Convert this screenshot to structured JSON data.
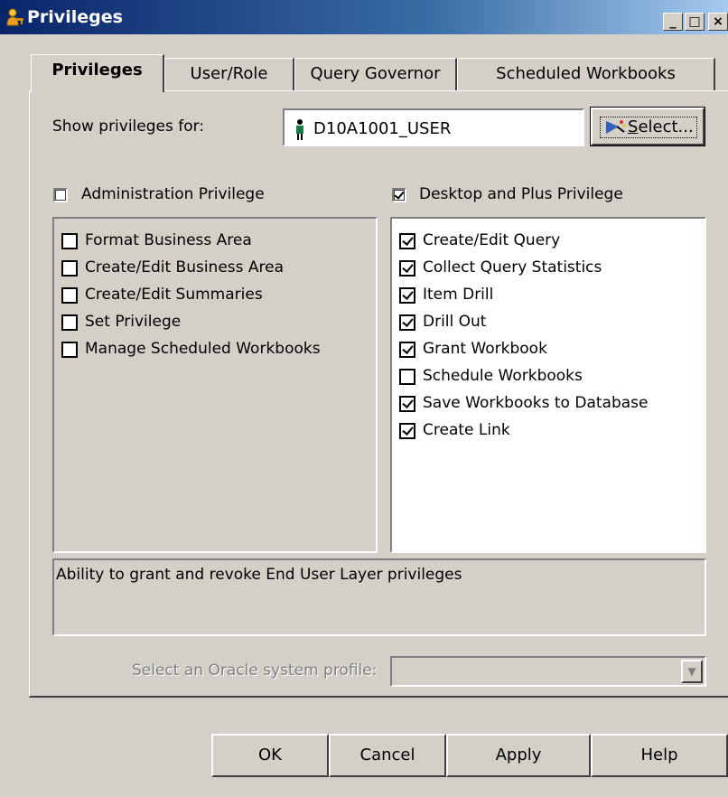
{
  "window": {
    "title": "Privileges",
    "controls": {
      "minimize": "_",
      "maximize": "□",
      "close": "×"
    }
  },
  "tabs": [
    {
      "label": "Privileges",
      "active": true
    },
    {
      "label": "User/Role",
      "active": false
    },
    {
      "label": "Query Governor",
      "active": false
    },
    {
      "label": "Scheduled Workbooks",
      "active": false
    }
  ],
  "show_for": {
    "label": "Show privileges for:",
    "user": "D10A1001_USER",
    "select_button_prefix": "S",
    "select_button_rest": "elect..."
  },
  "admin": {
    "label": "Administration Privilege",
    "checked": false,
    "items": [
      {
        "label": "Format Business Area",
        "checked": false
      },
      {
        "label": "Create/Edit Business Area",
        "checked": false
      },
      {
        "label": "Create/Edit Summaries",
        "checked": false
      },
      {
        "label": "Set Privilege",
        "checked": false
      },
      {
        "label": "Manage Scheduled Workbooks",
        "checked": false
      }
    ]
  },
  "desktop": {
    "label": "Desktop and Plus Privilege",
    "checked": true,
    "items": [
      {
        "label": "Create/Edit Query",
        "checked": true
      },
      {
        "label": "Collect Query Statistics",
        "checked": true
      },
      {
        "label": "Item Drill",
        "checked": true
      },
      {
        "label": "Drill Out",
        "checked": true
      },
      {
        "label": "Grant Workbook",
        "checked": true
      },
      {
        "label": "Schedule Workbooks",
        "checked": false
      },
      {
        "label": "Save Workbooks to Database",
        "checked": true
      },
      {
        "label": "Create Link",
        "checked": true
      }
    ]
  },
  "description": "Ability to grant and revoke End User Layer privileges",
  "profile": {
    "label": "Select an Oracle system profile:",
    "value": "",
    "arrow": "▼"
  },
  "buttons": {
    "ok": "OK",
    "cancel": "Cancel",
    "apply": "Apply",
    "help": "Help"
  },
  "colors": {
    "titlebar": "#0a246a",
    "face": "#d4d0c8"
  }
}
